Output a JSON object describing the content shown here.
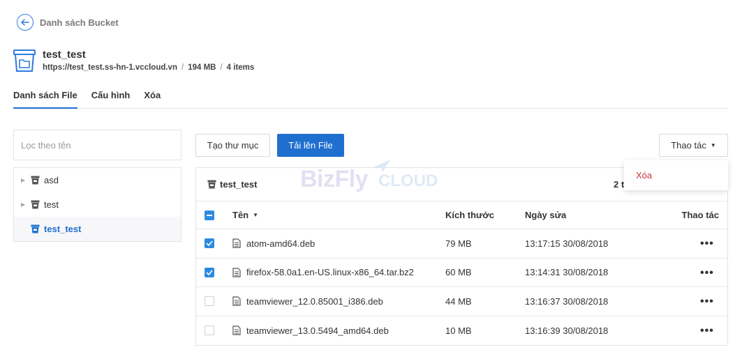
{
  "back": {
    "label": "Danh sách Bucket"
  },
  "bucket": {
    "name": "test_test",
    "url": "https://test_test.ss-hn-1.vccloud.vn",
    "size": "194 MB",
    "items": "4 items"
  },
  "tabs": [
    {
      "label": "Danh sách File",
      "active": true
    },
    {
      "label": "Cấu hình",
      "active": false
    },
    {
      "label": "Xóa",
      "active": false
    }
  ],
  "filter": {
    "placeholder": "Lọc theo tên",
    "value": ""
  },
  "tree": [
    {
      "label": "asd",
      "selected": false
    },
    {
      "label": "test",
      "selected": false
    },
    {
      "label": "test_test",
      "selected": true
    }
  ],
  "toolbar": {
    "create_folder": "Tạo thư mục",
    "upload": "Tải lên File",
    "actions": "Thao tác"
  },
  "dropdown": {
    "delete": "Xóa"
  },
  "watermark": {
    "biz": "BizFly",
    "cloud": "CLOUD"
  },
  "panel": {
    "title": "test_test",
    "count": "2 t"
  },
  "table": {
    "columns": {
      "name": "Tên",
      "size": "Kích thước",
      "date": "Ngày sửa",
      "actions": "Thao tác"
    },
    "rows": [
      {
        "name": "atom-amd64.deb",
        "size": "79 MB",
        "date": "13:17:15 30/08/2018",
        "checked": true
      },
      {
        "name": "firefox-58.0a1.en-US.linux-x86_64.tar.bz2",
        "size": "60 MB",
        "date": "13:14:31 30/08/2018",
        "checked": true
      },
      {
        "name": "teamviewer_12.0.85001_i386.deb",
        "size": "44 MB",
        "date": "13:16:37 30/08/2018",
        "checked": false
      },
      {
        "name": "teamviewer_13.0.5494_amd64.deb",
        "size": "10 MB",
        "date": "13:16:39 30/08/2018",
        "checked": false
      }
    ]
  },
  "colors": {
    "primary": "#1f6fcf",
    "danger": "#d0343a",
    "checkbox": "#2d8ae0"
  }
}
